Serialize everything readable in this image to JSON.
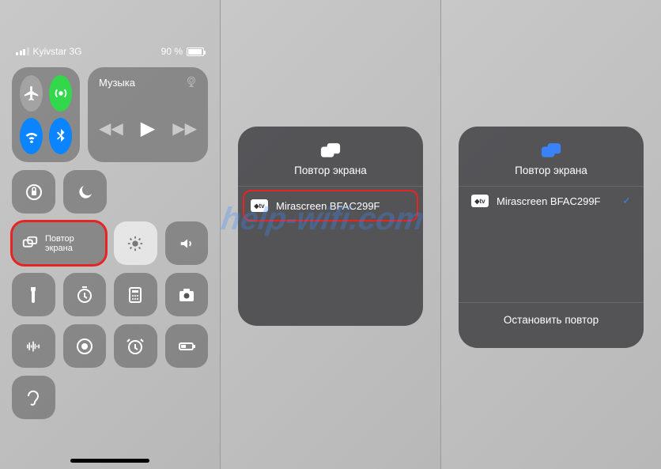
{
  "status": {
    "carrier": "Kyivstar 3G",
    "battery_pct": "90 %"
  },
  "music": {
    "title": "Музыка"
  },
  "screen_mirror": {
    "label_line1": "Повтор",
    "label_line2": "экрана"
  },
  "sheet": {
    "title": "Повтор экрана",
    "device": "Mirascreen BFAC299F",
    "device_chip": "◆tv",
    "stop": "Остановить повтор"
  },
  "watermark": "help-wifi.com"
}
